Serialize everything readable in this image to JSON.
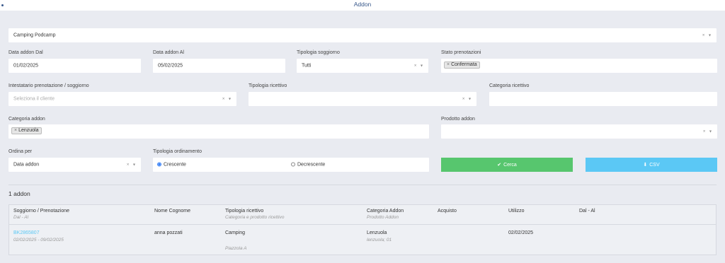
{
  "header": {
    "title": "Addon"
  },
  "filters": {
    "structure": {
      "value": "Camping Podcamp"
    },
    "date_from": {
      "label": "Data addon Dal",
      "value": "01/02/2025"
    },
    "date_to": {
      "label": "Data addon Al",
      "value": "05/02/2025"
    },
    "stay_type": {
      "label": "Tipologia soggiorno",
      "value": "Tutti"
    },
    "booking_status": {
      "label": "Stato prenotazioni",
      "tag": "Confermata"
    },
    "holder": {
      "label": "Intestatario prenotazione / soggiorno",
      "placeholder": "Seleziona il cliente"
    },
    "accommodation_type": {
      "label": "Tipologia ricettivo",
      "value": ""
    },
    "accommodation_category": {
      "label": "Categoria ricettivo",
      "value": ""
    },
    "addon_category": {
      "label": "Categoria addon",
      "tag": "Lenzuola"
    },
    "addon_product": {
      "label": "Prodotto addon",
      "value": ""
    },
    "order_by": {
      "label": "Ordina per",
      "value": "Data addon"
    },
    "order_type": {
      "label": "Tipologia ordinamento",
      "options": [
        "Crescente",
        "Decrescente"
      ],
      "selected": "Crescente"
    }
  },
  "buttons": {
    "search": "Cerca",
    "csv": "CSV"
  },
  "icons": {
    "search": "check-icon",
    "csv": "download-icon",
    "clear": "×",
    "dropdown": "▾"
  },
  "colors": {
    "search_bg": "#57c66e",
    "csv_bg": "#5bc8f5",
    "link": "#5bc8f5"
  },
  "results": {
    "count_label": "1 addon",
    "columns": [
      {
        "label": "Soggiorno / Prenotazione",
        "sub": "Dal - Al"
      },
      {
        "label": "Nome Cognome",
        "sub": ""
      },
      {
        "label": "Tipologia ricettivo",
        "sub": "Categoria e prodotto ricettivo"
      },
      {
        "label": "Categoria Addon",
        "sub": "Prodotto Addon"
      },
      {
        "label": "Acquisto",
        "sub": ""
      },
      {
        "label": "Utilizzo",
        "sub": ""
      },
      {
        "label": "Dal - Al",
        "sub": ""
      }
    ],
    "rows": [
      {
        "code": "BK2865807",
        "dates": "02/02/2025 - 09/02/2025",
        "name": "anna pozzati",
        "accommodation_type": "Camping",
        "accommodation_product": "Piazzola A",
        "addon_category": "Lenzuola",
        "addon_product": "lenzuola; 01",
        "purchase": "",
        "usage": "02/02/2025",
        "period": ""
      }
    ]
  }
}
